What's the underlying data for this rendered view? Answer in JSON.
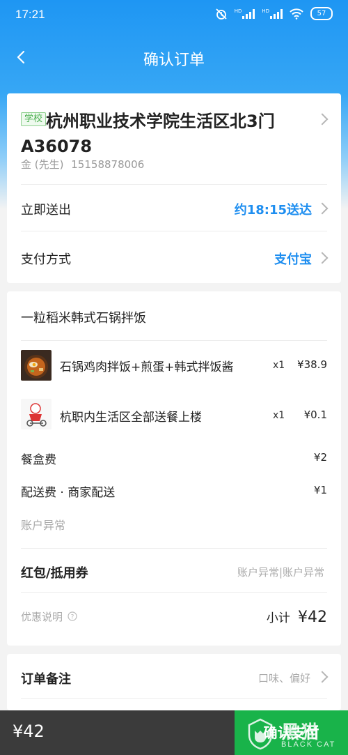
{
  "status_bar": {
    "time": "17:21",
    "net1": "HD",
    "net2": "HD",
    "battery": "57"
  },
  "nav": {
    "title": "确认订单"
  },
  "address": {
    "tag": "学校",
    "text": "杭州职业技术学院生活区北3门A36078",
    "name": "金 (先生)",
    "phone": "15158878006"
  },
  "delivery": {
    "label": "立即送出",
    "value": "约18:15送达"
  },
  "payment": {
    "label": "支付方式",
    "value": "支付宝"
  },
  "order": {
    "shop_name": "一粒稻米韩式石锅拌饭",
    "items": [
      {
        "name": "石锅鸡肉拌饭+煎蛋+韩式拌饭酱",
        "qty": "x1",
        "price": "¥38.9"
      },
      {
        "name": "杭职内生活区全部送餐上楼",
        "qty": "x1",
        "price": "¥0.1"
      }
    ],
    "box_fee": {
      "label": "餐盒费",
      "value": "¥2"
    },
    "delivery_fee": {
      "label": "配送费 · 商家配送",
      "value": "¥1"
    },
    "account_status": "账户异常",
    "coupon": {
      "label": "红包/抵用券",
      "value": "账户异常|账户异常"
    },
    "discount_label": "优惠说明",
    "subtotal_label": "小计",
    "subtotal_value": "¥42"
  },
  "remarks": {
    "label": "订单备注",
    "placeholder": "口味、偏好"
  },
  "bottom": {
    "total": "¥42",
    "pay_button": "确认支付"
  },
  "watermark": {
    "text": "黑猫",
    "sub": "BLACK CAT"
  },
  "colors": {
    "accent": "#1e8ef0",
    "header": "#1e96f3",
    "pay_button": "#19b34a",
    "bottom_bar": "#3b3b3b"
  }
}
